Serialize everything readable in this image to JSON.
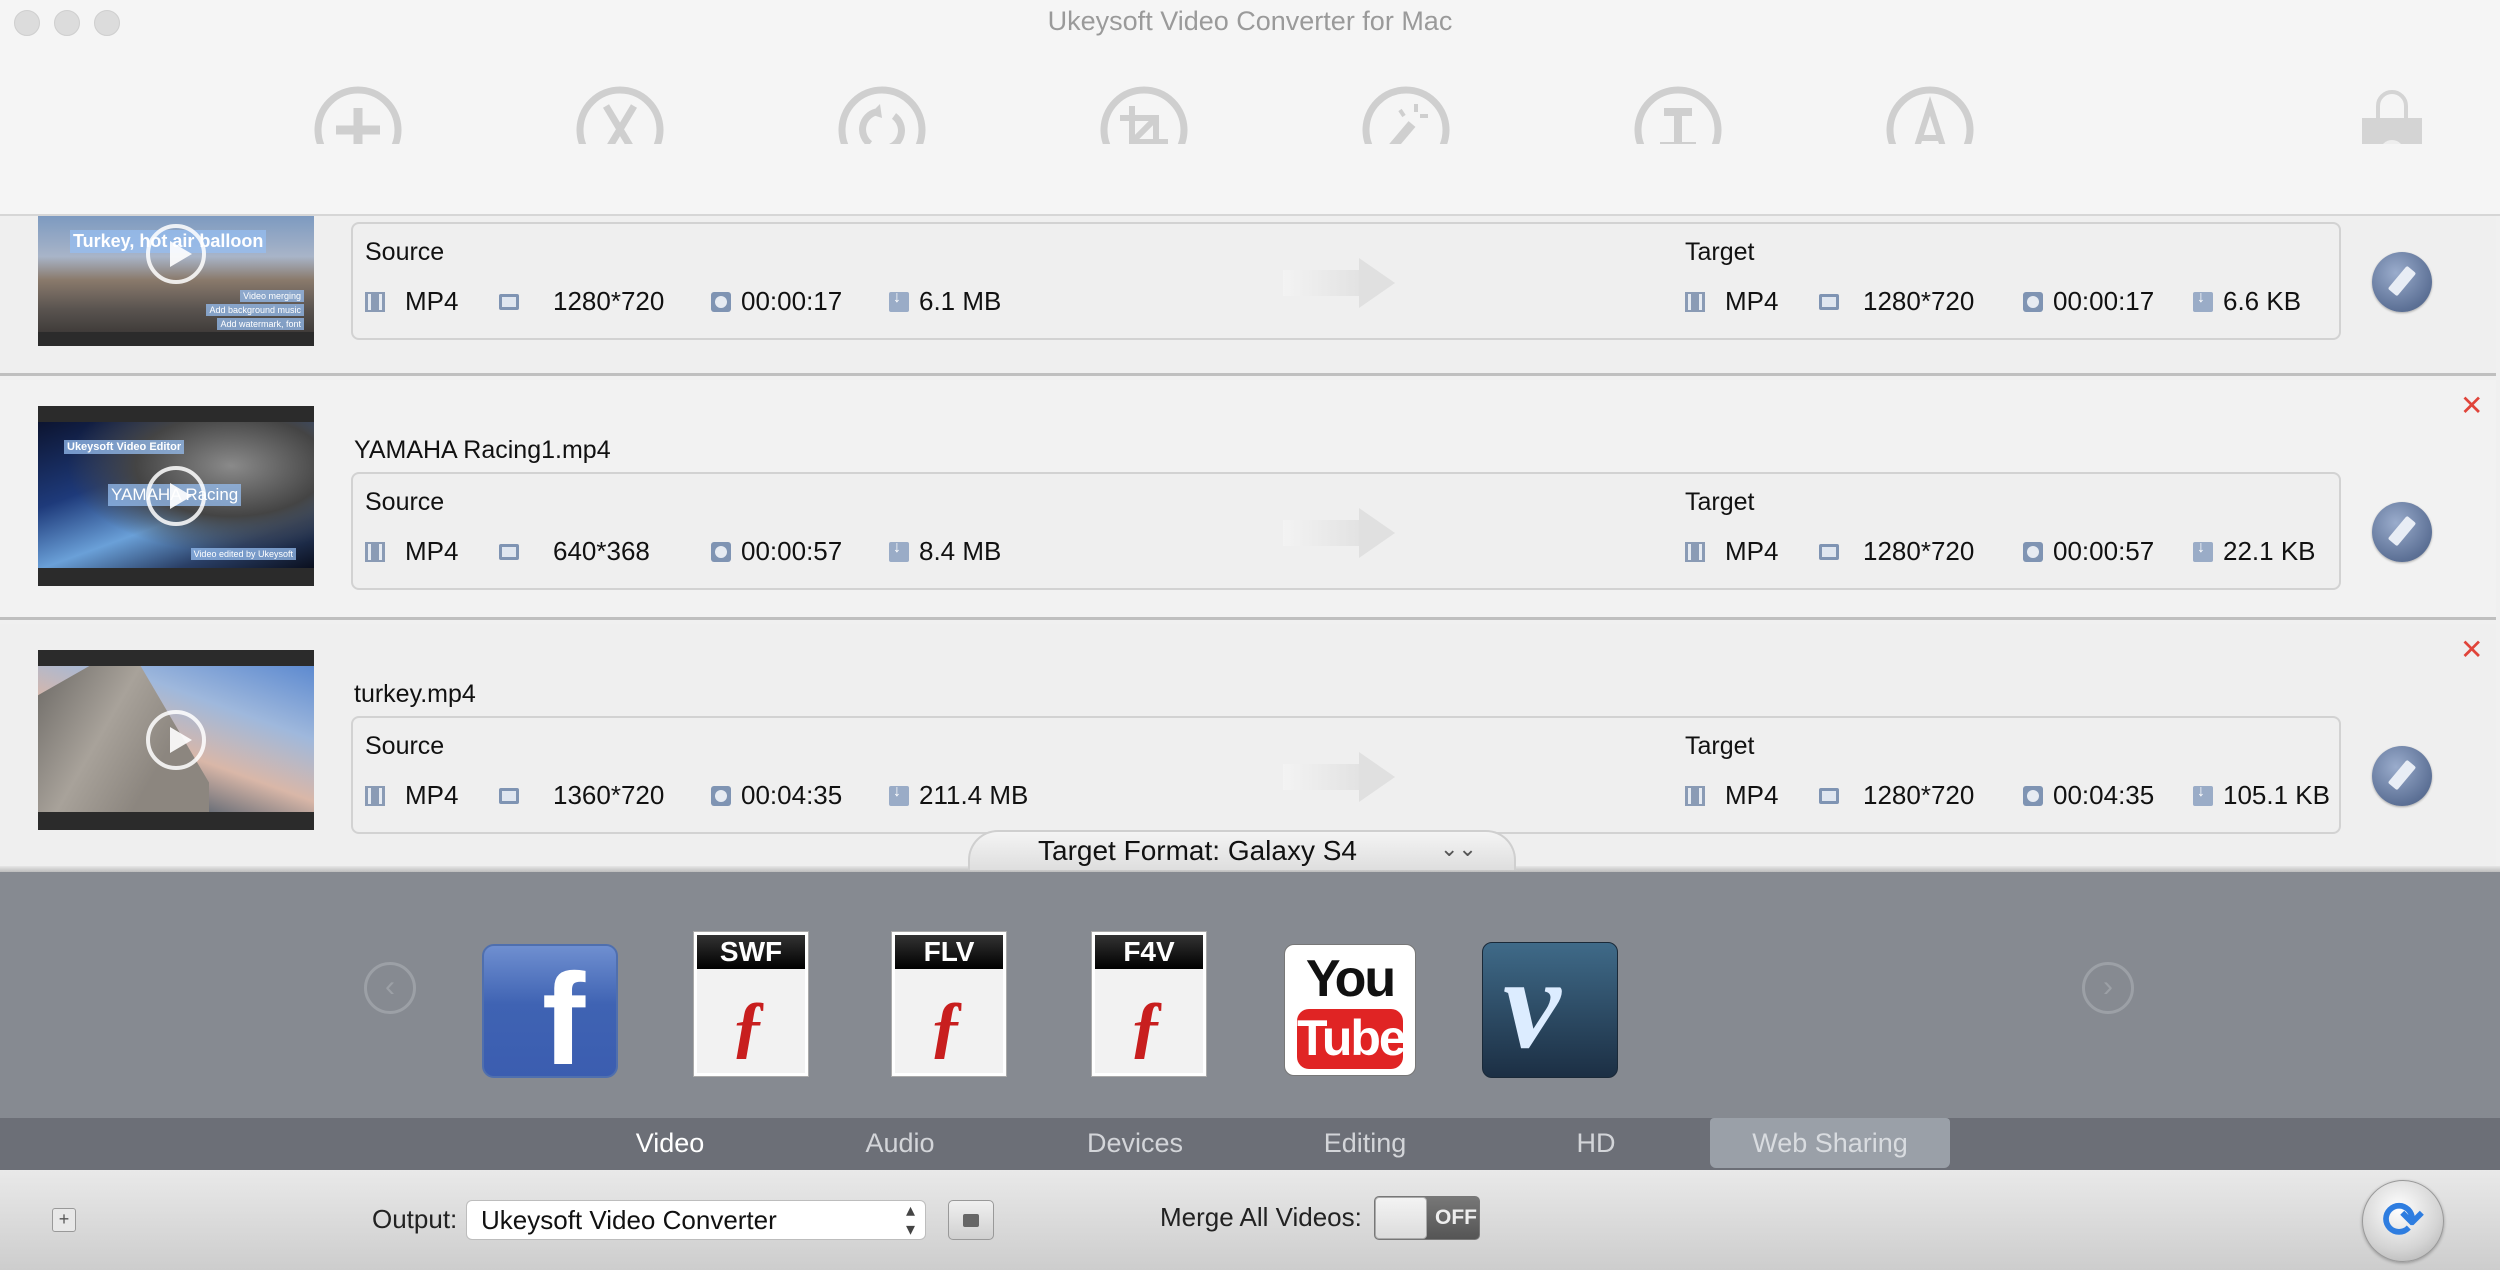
{
  "window": {
    "title": "Ukeysoft Video Converter for Mac"
  },
  "toolbar": {
    "buttons": [
      {
        "name": "add-video",
        "icon": "plus-circle-icon"
      },
      {
        "name": "trim",
        "icon": "scissors-icon"
      },
      {
        "name": "rotate",
        "icon": "rotate-icon"
      },
      {
        "name": "crop",
        "icon": "crop-icon"
      },
      {
        "name": "effect",
        "icon": "magic-wand-icon"
      },
      {
        "name": "watermark",
        "icon": "text-watermark-icon"
      },
      {
        "name": "subtitle",
        "icon": "letter-a-icon"
      },
      {
        "name": "store",
        "icon": "shopping-bag-icon"
      }
    ]
  },
  "files": [
    {
      "name": "",
      "thumbnail_caption": "Turkey, hot air balloon",
      "thumbnail_notes": [
        "Video merging",
        "Add background music",
        "Add watermark, font"
      ],
      "source": {
        "label": "Source",
        "format": "MP4",
        "resolution": "1280*720",
        "duration": "00:00:17",
        "size": "6.1 MB"
      },
      "target": {
        "label": "Target",
        "format": "MP4",
        "resolution": "1280*720",
        "duration": "00:00:17",
        "size": "6.6 KB"
      }
    },
    {
      "name": "YAMAHA Racing1.mp4",
      "thumbnail_caption": "YAMAHA Racing",
      "thumbnail_notes": [
        "Ukeysoft Video Editor",
        "Video edited by Ukeysoft"
      ],
      "source": {
        "label": "Source",
        "format": "MP4",
        "resolution": "640*368",
        "duration": "00:00:57",
        "size": "8.4 MB"
      },
      "target": {
        "label": "Target",
        "format": "MP4",
        "resolution": "1280*720",
        "duration": "00:00:57",
        "size": "22.1 KB"
      }
    },
    {
      "name": "turkey.mp4",
      "thumbnail_caption": "",
      "thumbnail_notes": [],
      "source": {
        "label": "Source",
        "format": "MP4",
        "resolution": "1360*720",
        "duration": "00:04:35",
        "size": "211.4 MB"
      },
      "target": {
        "label": "Target",
        "format": "MP4",
        "resolution": "1280*720",
        "duration": "00:04:35",
        "size": "105.1 KB"
      }
    }
  ],
  "remove_symbol": "✕",
  "target_format": {
    "label": "Target Format: Galaxy S4",
    "chevron": "⌄⌄"
  },
  "gallery": {
    "prev": "‹",
    "next": "›",
    "formats": [
      {
        "name": "Facebook",
        "glyph": "f"
      },
      {
        "name": "SWF",
        "header": "SWF",
        "glyph": "ƒ"
      },
      {
        "name": "FLV",
        "header": "FLV",
        "glyph": "ƒ"
      },
      {
        "name": "F4V",
        "header": "F4V",
        "glyph": "ƒ"
      },
      {
        "name": "YouTube",
        "top": "You",
        "bottom": "Tube"
      },
      {
        "name": "Vimeo",
        "glyph": "v"
      }
    ]
  },
  "category_tabs": {
    "items": [
      "Video",
      "Audio",
      "Devices",
      "Editing",
      "HD",
      "Web Sharing"
    ],
    "selected": "Web Sharing"
  },
  "bottom": {
    "add_symbol": "+",
    "output_label": "Output:",
    "output_value": "Ukeysoft Video Converter",
    "updown": "⌃⌄",
    "merge_label": "Merge All Videos:",
    "merge_state": "OFF",
    "convert_symbol": "⟳"
  },
  "colors": {
    "accent_blue": "#2e7de0",
    "remove_red": "#e0443a",
    "gallery_bg": "#868a91",
    "tabs_bg": "#6c6f77"
  }
}
